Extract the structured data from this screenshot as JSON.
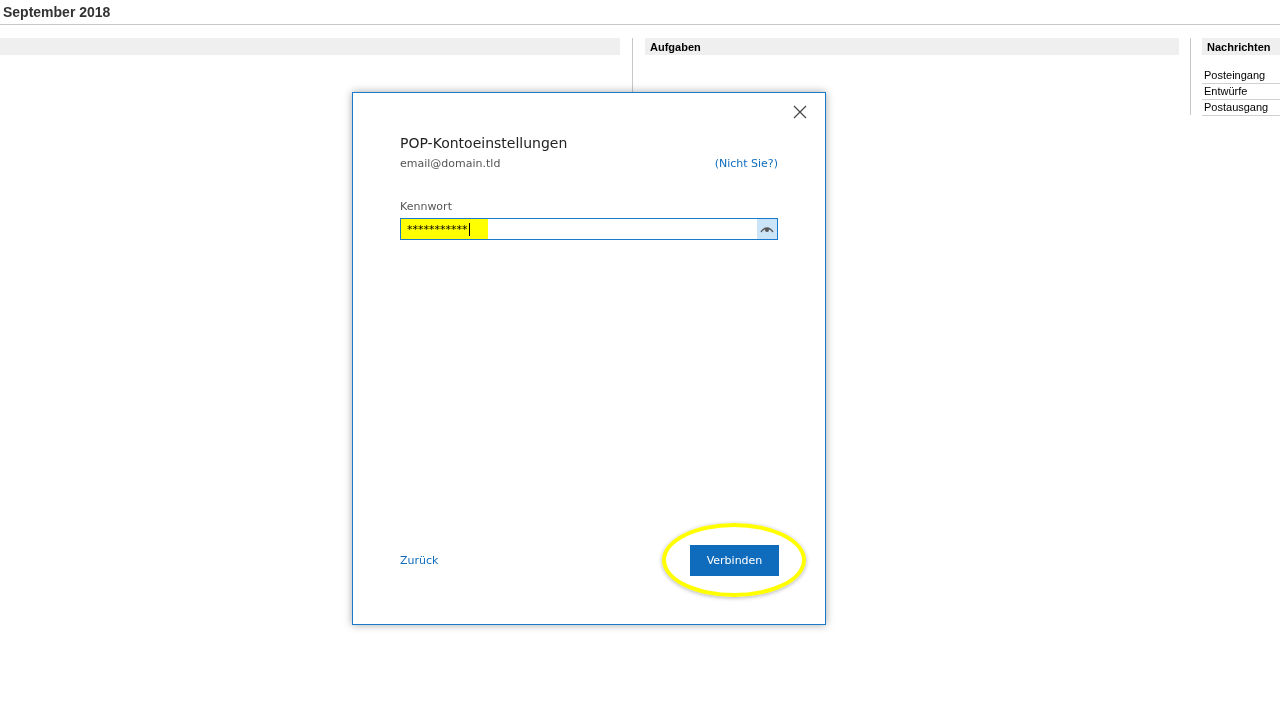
{
  "header": {
    "title": "September 2018"
  },
  "tasks": {
    "title": "Aufgaben"
  },
  "messages": {
    "title": "Nachrichten",
    "folders": [
      "Posteingang",
      "Entwürfe",
      "Postausgang"
    ]
  },
  "dialog": {
    "title": "POP-Kontoeinstellungen",
    "account": "email@domain.tld",
    "not_you": "(Nicht Sie?)",
    "password": {
      "label": "Kennwort",
      "value": "***********",
      "highlighted": true
    },
    "back": "Zurück",
    "connect": {
      "label": "Verbinden",
      "circled": true
    }
  }
}
